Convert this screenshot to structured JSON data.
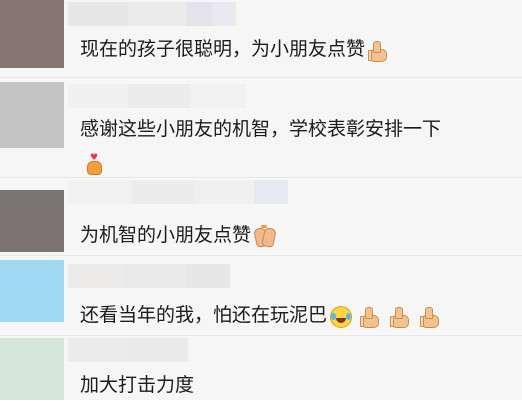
{
  "comments": [
    {
      "text": "现在的孩子很聪明，为小朋友点赞",
      "emoji": [
        "thumbs-up"
      ]
    },
    {
      "text": "感谢这些小朋友的机智，学校表彰安排一下",
      "emoji": [
        "heart-gift"
      ]
    },
    {
      "text": "为机智的小朋友点赞",
      "emoji": [
        "clapping-hands"
      ]
    },
    {
      "text": "还看当年的我，怕还在玩泥巴",
      "emoji": [
        "laughing-tears",
        "thumbs-up",
        "thumbs-up",
        "thumbs-up"
      ]
    },
    {
      "text": "加大打击力度",
      "emoji": []
    }
  ],
  "colors": {
    "background": "#f6f6f6",
    "text": "#1b1b1b"
  }
}
